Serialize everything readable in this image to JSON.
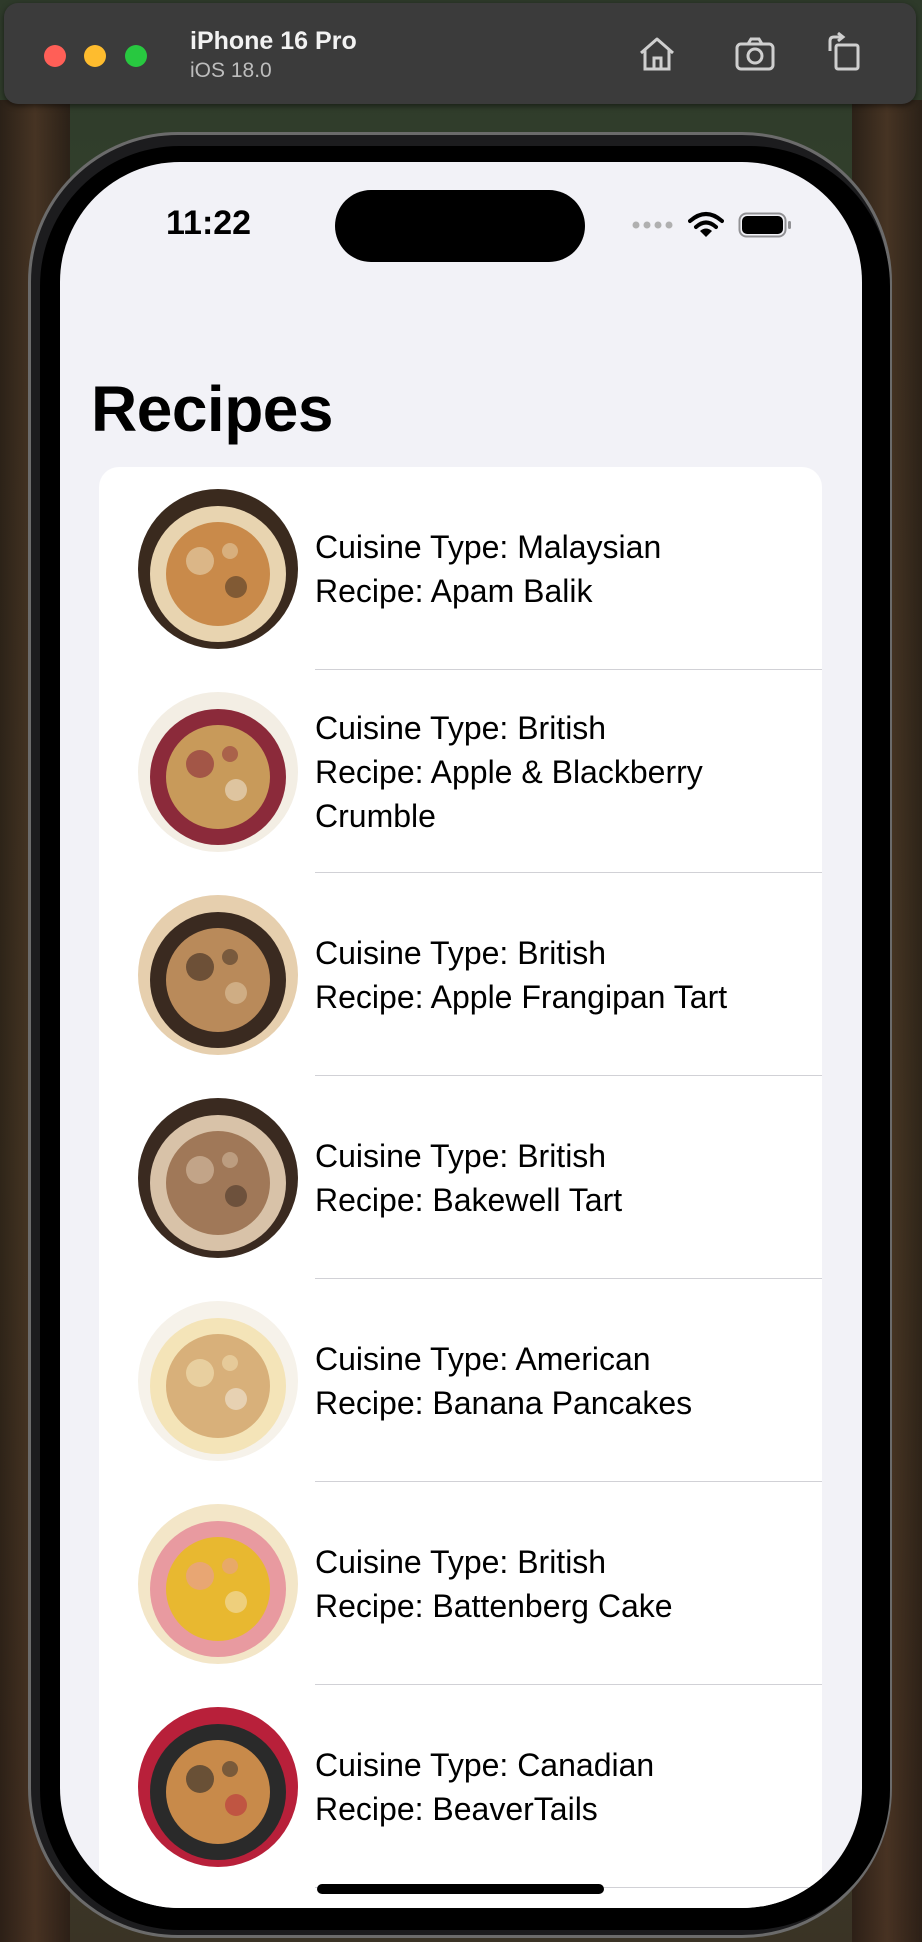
{
  "simulator": {
    "device_name": "iPhone 16 Pro",
    "os_version": "iOS 18.0",
    "home_icon": "home-icon",
    "screenshot_icon": "camera-icon",
    "rotate_icon": "rotate-icon"
  },
  "status_bar": {
    "time": "11:22",
    "signal_icon": "cellular-dots-icon",
    "wifi_icon": "wifi-icon",
    "battery_icon": "battery-icon"
  },
  "nav": {
    "title": "Recipes"
  },
  "recipes": [
    {
      "cuisine": "Cuisine Type: Malaysian",
      "name": "Recipe: Apam Balik",
      "image": "apam-balik-photo",
      "colors": [
        "#c98a4a",
        "#e8d4b0",
        "#3a2a1e"
      ]
    },
    {
      "cuisine": "Cuisine Type: British",
      "name": "Recipe: Apple & Blackberry Crumble",
      "image": "crumble-photo",
      "colors": [
        "#c89a5a",
        "#8b2a3a",
        "#f3eee4"
      ]
    },
    {
      "cuisine": "Cuisine Type: British",
      "name": "Recipe: Apple Frangipan Tart",
      "image": "frangipan-tart-photo",
      "colors": [
        "#b98a5a",
        "#3a2a20",
        "#e6cfae"
      ]
    },
    {
      "cuisine": "Cuisine Type: British",
      "name": "Recipe: Bakewell Tart",
      "image": "bakewell-tart-photo",
      "colors": [
        "#a07858",
        "#d8c2a8",
        "#3a2a20"
      ]
    },
    {
      "cuisine": "Cuisine Type: American",
      "name": "Recipe: Banana Pancakes",
      "image": "banana-pancakes-photo",
      "colors": [
        "#d8b07a",
        "#f4e4b8",
        "#f6f2ea"
      ]
    },
    {
      "cuisine": "Cuisine Type: British",
      "name": "Recipe: Battenberg Cake",
      "image": "battenberg-cake-photo",
      "colors": [
        "#e8b830",
        "#e89aa0",
        "#f3e6c8"
      ]
    },
    {
      "cuisine": "Cuisine Type: Canadian",
      "name": "Recipe: BeaverTails",
      "image": "beavertails-photo",
      "colors": [
        "#c88a4a",
        "#2a2a2a",
        "#b8203a"
      ]
    }
  ]
}
